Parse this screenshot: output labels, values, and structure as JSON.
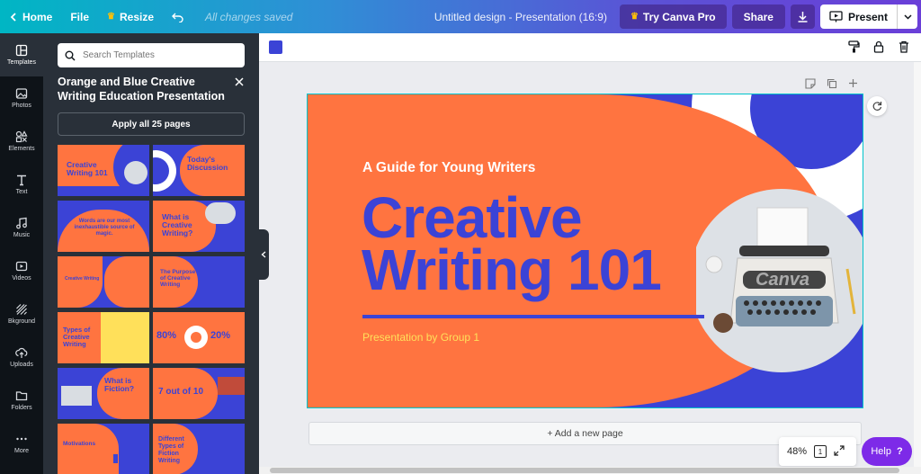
{
  "topbar": {
    "home": "Home",
    "file": "File",
    "resize": "Resize",
    "saved": "All changes saved",
    "doc_title": "Untitled design - Presentation (16:9)",
    "try_pro": "Try Canva Pro",
    "share": "Share",
    "present": "Present"
  },
  "rail": {
    "items": [
      {
        "label": "Templates",
        "icon": "templates-icon"
      },
      {
        "label": "Photos",
        "icon": "photos-icon"
      },
      {
        "label": "Elements",
        "icon": "elements-icon"
      },
      {
        "label": "Text",
        "icon": "text-icon"
      },
      {
        "label": "Music",
        "icon": "music-icon"
      },
      {
        "label": "Videos",
        "icon": "videos-icon"
      },
      {
        "label": "Bkground",
        "icon": "background-icon"
      },
      {
        "label": "Uploads",
        "icon": "uploads-icon"
      },
      {
        "label": "Folders",
        "icon": "folders-icon"
      },
      {
        "label": "More",
        "icon": "more-icon"
      }
    ]
  },
  "panel": {
    "search_placeholder": "Search Templates",
    "title": "Orange and Blue Creative Writing Education Presentation",
    "apply": "Apply all 25 pages",
    "thumbs": [
      {
        "title": "Creative Writing 101"
      },
      {
        "title": "Today's Discussion"
      },
      {
        "title": "Words are our most inexhaustible source of magic."
      },
      {
        "title": "What is Creative Writing?"
      },
      {
        "title": "Creative Writing"
      },
      {
        "title": "The Purpose of Creative Writing"
      },
      {
        "title": "Types of Creative Writing"
      },
      {
        "title": "80%",
        "title2": "20%"
      },
      {
        "title": "What is Fiction?"
      },
      {
        "title": "7 out of 10"
      },
      {
        "title": "Motivations"
      },
      {
        "title": "Different Types of Fiction Writing"
      }
    ]
  },
  "slide": {
    "subtitle": "A Guide for Young Writers",
    "title_line1": "Creative",
    "title_line2": "Writing 101",
    "byline": "Presentation by Group 1",
    "watermark": "Canva"
  },
  "canvas": {
    "add_page": "+ Add a new page",
    "zoom": "48%",
    "page_number": "1",
    "help": "Help",
    "swatch_color": "#3b43d6"
  },
  "colors": {
    "orange": "#ff7440",
    "blue": "#3b43d6",
    "yellow": "#ffe05a"
  }
}
